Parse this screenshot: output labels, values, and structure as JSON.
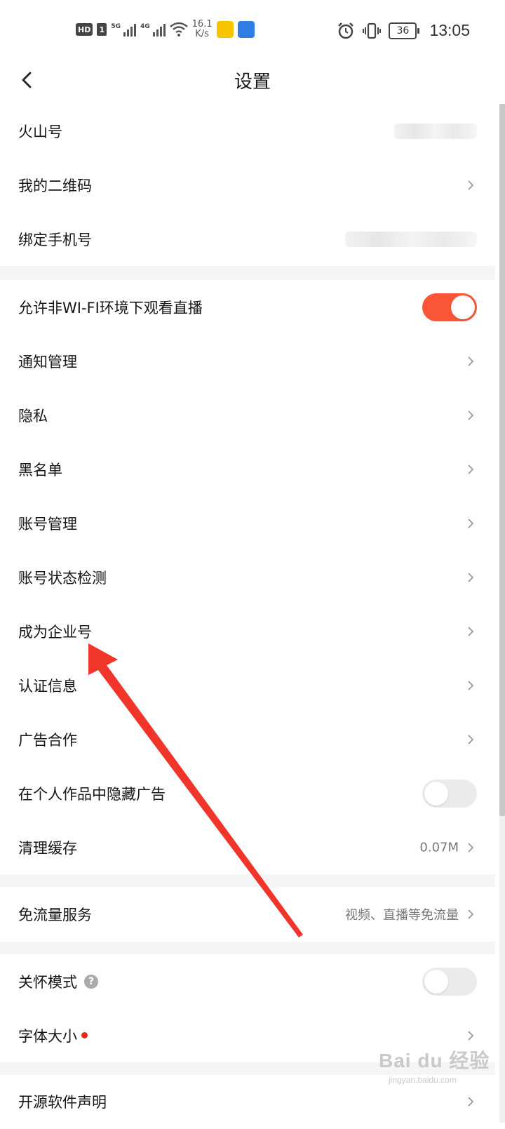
{
  "status_bar": {
    "hd": "HD",
    "sim": "1",
    "net1": "5G",
    "net2": "4G",
    "speed_value": "16.1",
    "speed_unit": "K/s",
    "battery": "36",
    "time": "13:05"
  },
  "header": {
    "title": "设置"
  },
  "rows": {
    "huoshan_id": {
      "label": "火山号"
    },
    "qr_code": {
      "label": "我的二维码"
    },
    "bind_phone": {
      "label": "绑定手机号"
    },
    "non_wifi_live": {
      "label": "允许非WI-FI环境下观看直播",
      "toggle": "on"
    },
    "notifications": {
      "label": "通知管理"
    },
    "privacy": {
      "label": "隐私"
    },
    "blacklist": {
      "label": "黑名单"
    },
    "account_manage": {
      "label": "账号管理"
    },
    "account_status": {
      "label": "账号状态检测"
    },
    "enterprise": {
      "label": "成为企业号"
    },
    "verification": {
      "label": "认证信息"
    },
    "ads": {
      "label": "广告合作"
    },
    "hide_ads": {
      "label": "在个人作品中隐藏广告",
      "toggle": "off"
    },
    "clear_cache": {
      "label": "清理缓存",
      "value": "0.07M"
    },
    "free_data": {
      "label": "免流量服务",
      "value": "视频、直播等免流量"
    },
    "care_mode": {
      "label": "关怀模式",
      "help": "?",
      "toggle": "off"
    },
    "font_size": {
      "label": "字体大小"
    },
    "open_source": {
      "label": "开源软件声明"
    }
  },
  "watermark": {
    "main": "Bai du 经验",
    "sub": "jingyan.baidu.com"
  },
  "colors": {
    "accent": "#fa5537",
    "annotation_arrow": "#f0352a",
    "separator": "#f5f5f5"
  }
}
